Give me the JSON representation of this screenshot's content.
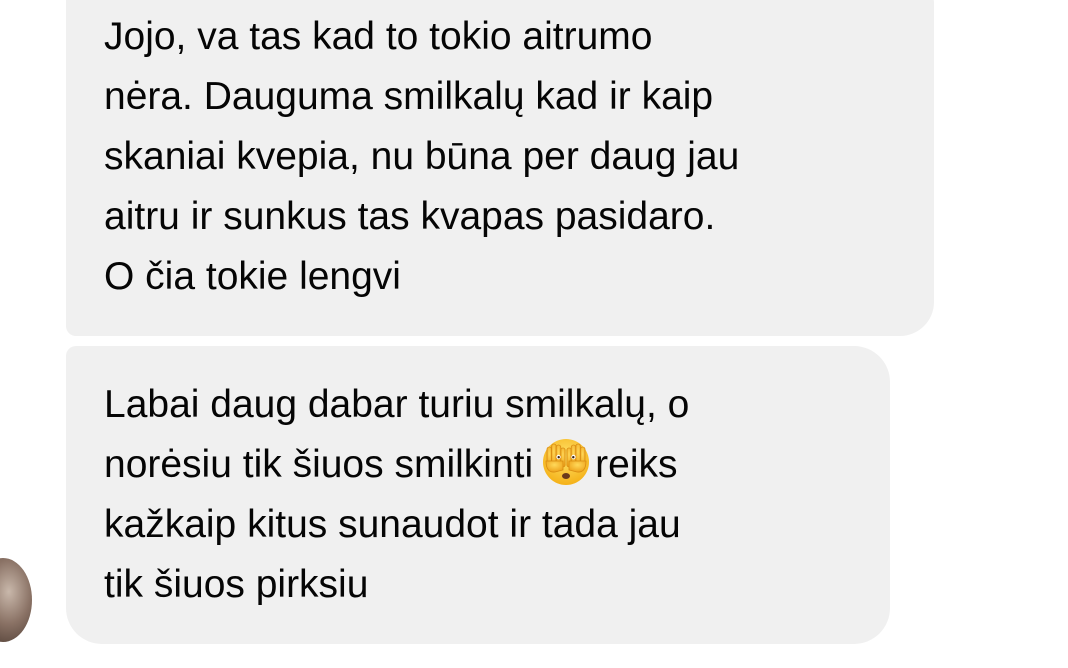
{
  "messages": [
    {
      "lines": [
        "Jojo, va tas kad to tokio aitrumo",
        "nėra. Dauguma smilkalų kad ir kaip",
        "skaniai kvepia, nu būna per daug jau",
        "aitru ir sunkus tas kvapas pasidaro.",
        "O čia tokie lengvi"
      ]
    },
    {
      "lines": [
        "Labai daug dabar turiu smilkalų, o",
        "norėsiu tik šiuos smilkinti",
        "reiks",
        "kažkaip kitus sunaudot ir tada jau",
        "tik šiuos pirksiu"
      ],
      "emoji": "face-with-hand-over-eyes-icon"
    }
  ],
  "colors": {
    "bubble_bg": "#f0f0f0",
    "text": "#050505",
    "background": "#ffffff"
  }
}
